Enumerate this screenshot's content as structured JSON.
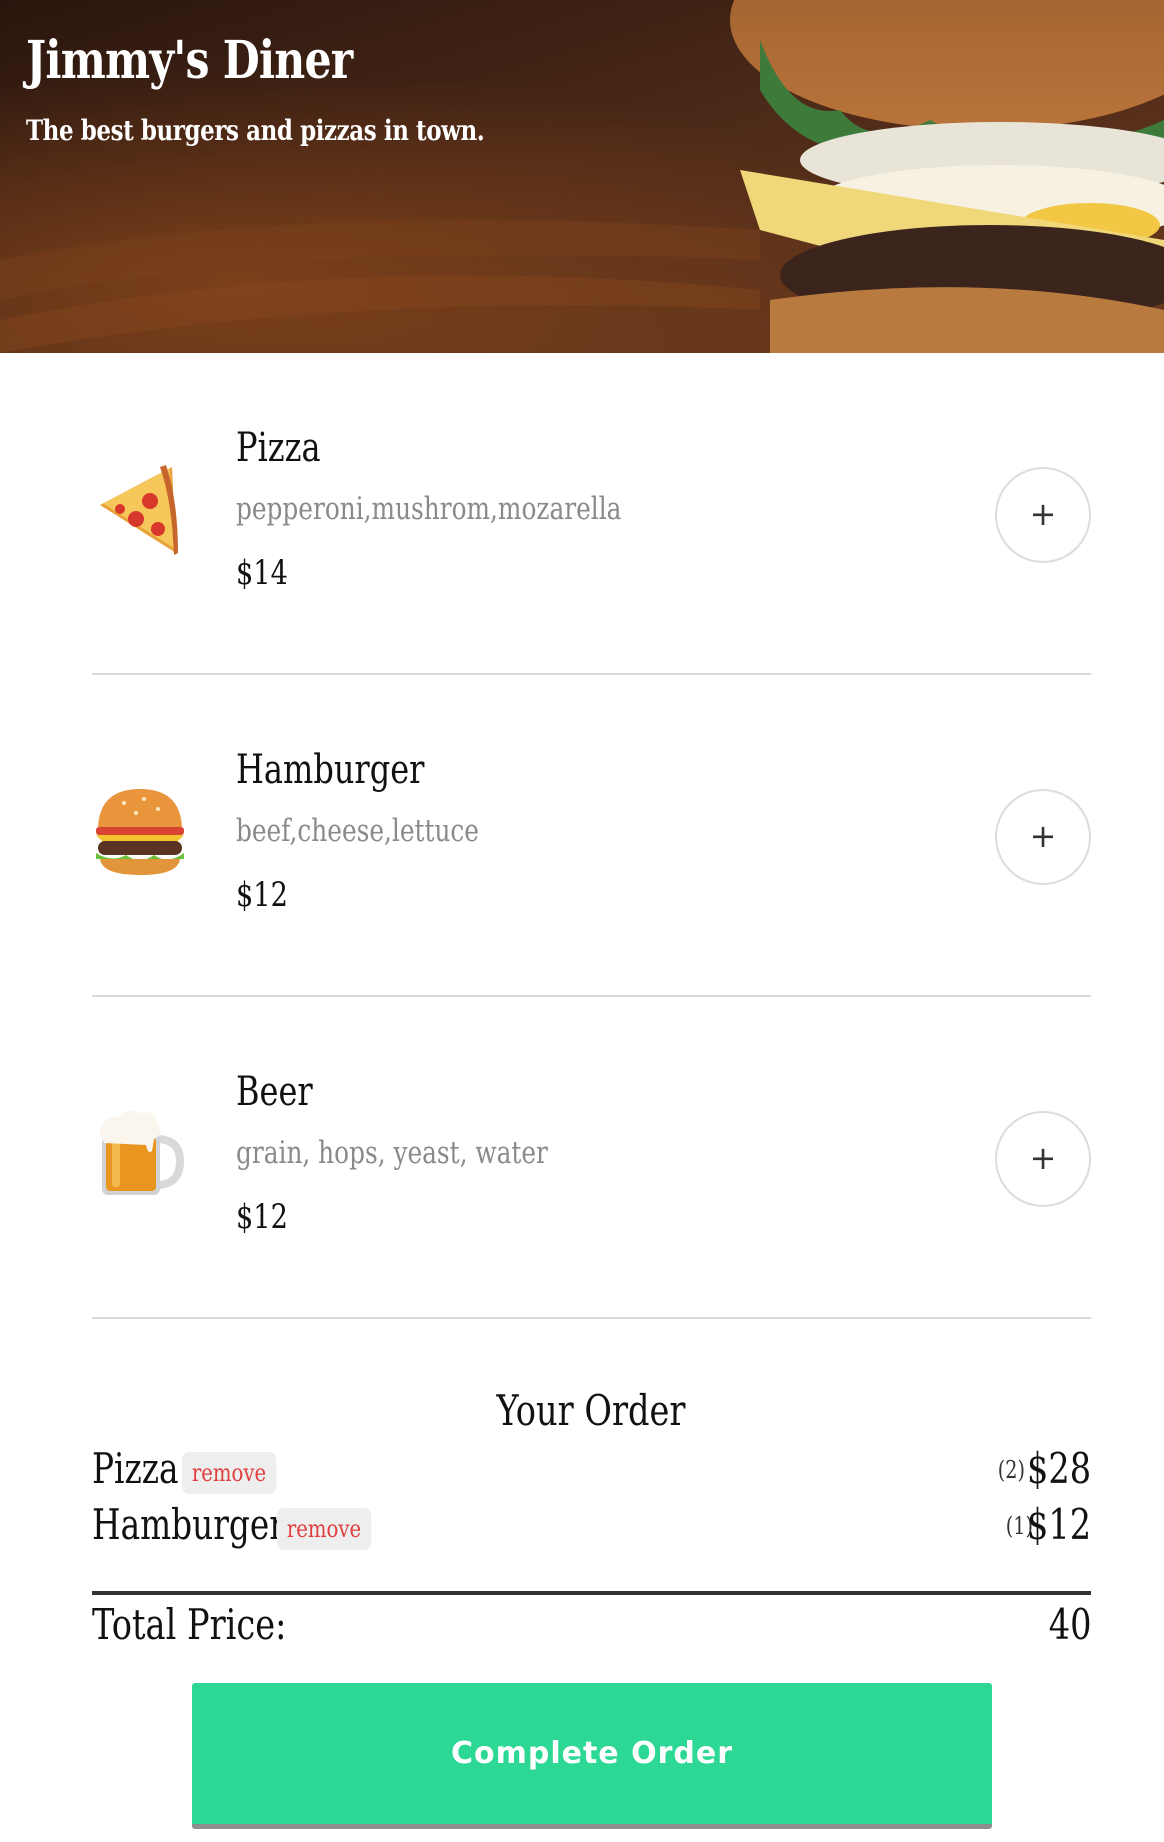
{
  "header": {
    "title": "Jimmy's Diner",
    "subtitle": "The best burgers and pizzas in town."
  },
  "menu": [
    {
      "icon": "pizza-icon",
      "name": "Pizza",
      "ingredients": "pepperoni,mushrom,mozarella",
      "price": "$14",
      "add_label": "+"
    },
    {
      "icon": "hamburger-icon",
      "name": "Hamburger",
      "ingredients": "beef,cheese,lettuce",
      "price": "$12",
      "add_label": "+"
    },
    {
      "icon": "beer-icon",
      "name": "Beer",
      "ingredients": "grain, hops, yeast, water",
      "price": "$12",
      "add_label": "+"
    }
  ],
  "order": {
    "title": "Your Order",
    "items": [
      {
        "name": "Pizza",
        "remove_label": "remove",
        "quantity": "(2)",
        "price": "$28"
      },
      {
        "name": "Hamburger",
        "remove_label": "remove",
        "quantity": "(1)",
        "price": "$12"
      }
    ],
    "total_label": "Total Price:",
    "total_value": "40",
    "complete_label": "Complete Order"
  },
  "colors": {
    "accent": "#2dd895",
    "remove_text": "#e04040",
    "muted_text": "#8a8a8a"
  }
}
